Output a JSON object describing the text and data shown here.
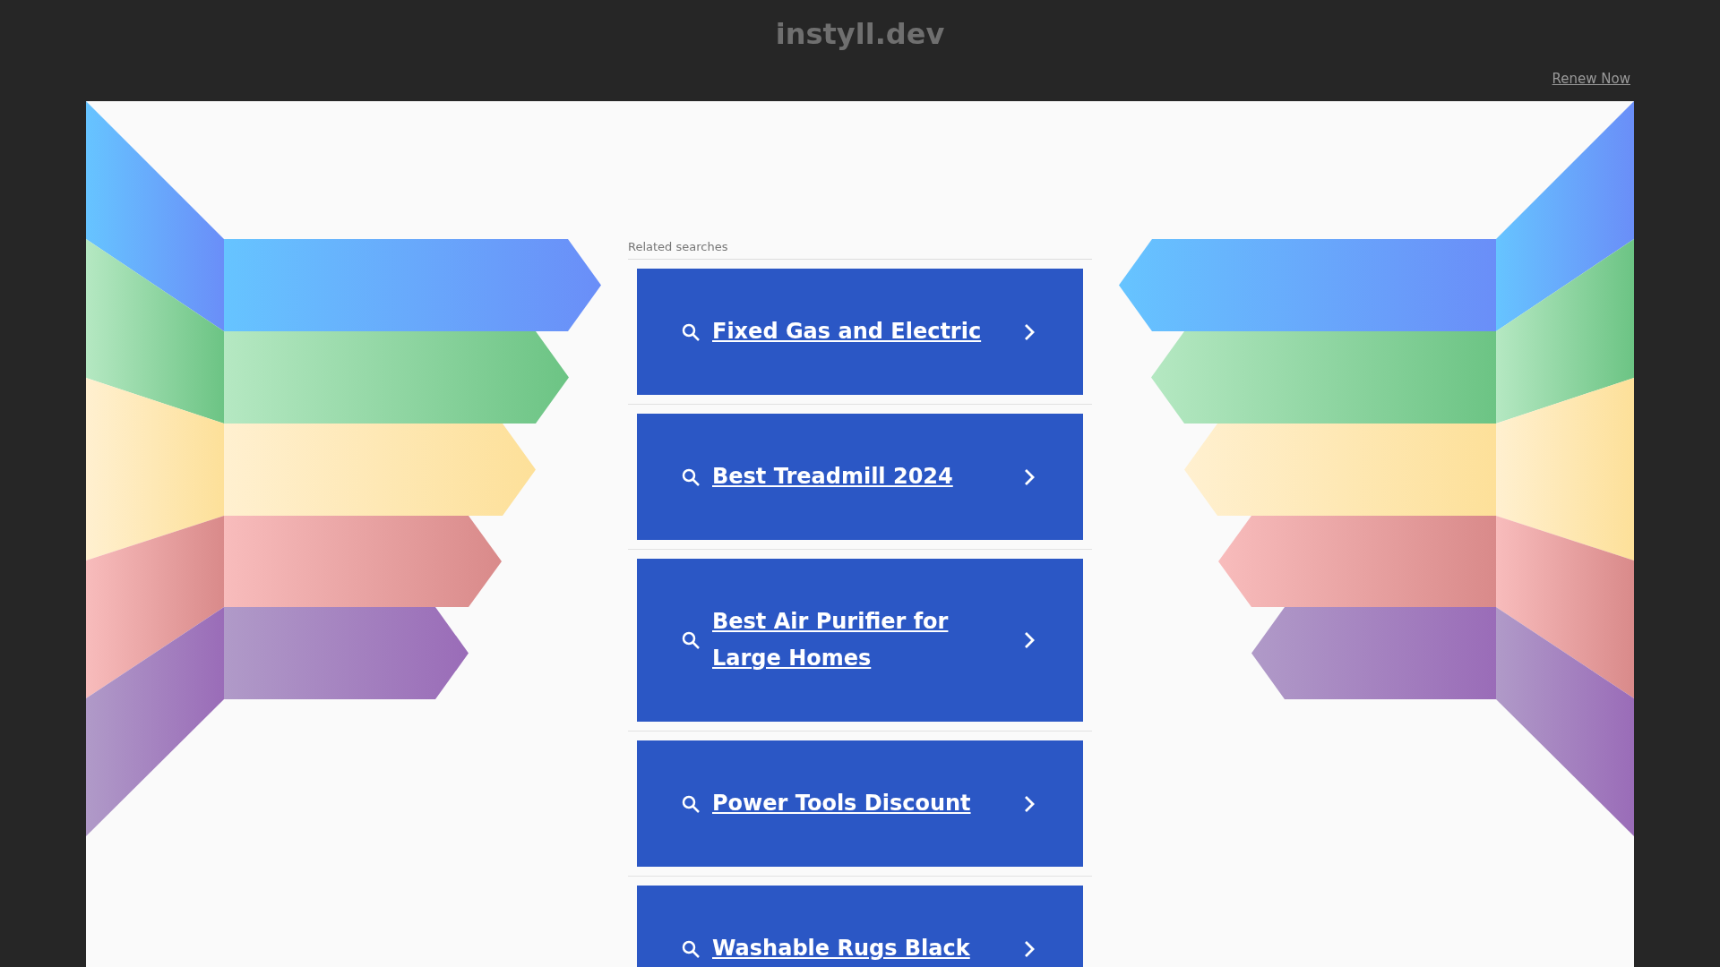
{
  "header": {
    "title": "instyll.dev",
    "renew_link": "Renew Now"
  },
  "related": {
    "heading": "Related searches",
    "items": [
      {
        "label": "Fixed Gas and Electric"
      },
      {
        "label": "Best Treadmill 2024"
      },
      {
        "label": "Best Air Purifier for Large Homes"
      },
      {
        "label": "Power Tools Discount"
      },
      {
        "label": "Washable Rugs Black"
      }
    ]
  }
}
